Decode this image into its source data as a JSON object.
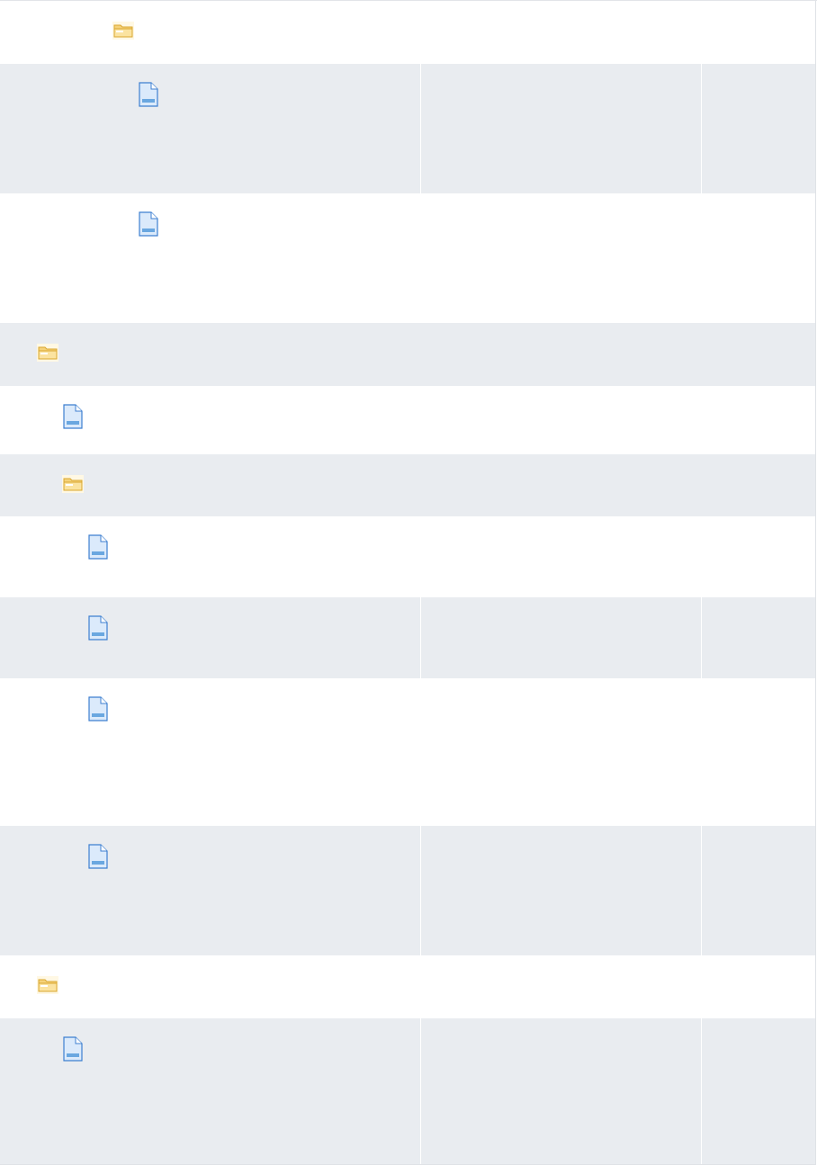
{
  "tree": {
    "rows": [
      {
        "type": "folder",
        "icon": "folder-icon",
        "label": ""
      },
      {
        "type": "file",
        "icon": "document-icon",
        "label": ""
      },
      {
        "type": "file",
        "icon": "document-icon",
        "label": ""
      },
      {
        "type": "folder",
        "icon": "folder-icon",
        "label": ""
      },
      {
        "type": "file",
        "icon": "document-icon",
        "label": ""
      },
      {
        "type": "folder",
        "icon": "folder-icon",
        "label": ""
      },
      {
        "type": "file",
        "icon": "document-icon",
        "label": ""
      },
      {
        "type": "file",
        "icon": "document-icon",
        "label": ""
      },
      {
        "type": "file",
        "icon": "document-icon",
        "label": ""
      },
      {
        "type": "file",
        "icon": "document-icon",
        "label": ""
      },
      {
        "type": "folder",
        "icon": "folder-icon",
        "label": ""
      },
      {
        "type": "file",
        "icon": "document-icon",
        "label": ""
      }
    ]
  },
  "colors": {
    "row_alt": "#e9ecf0",
    "folder": "#f2c55c",
    "document": "#6aa7e0"
  }
}
